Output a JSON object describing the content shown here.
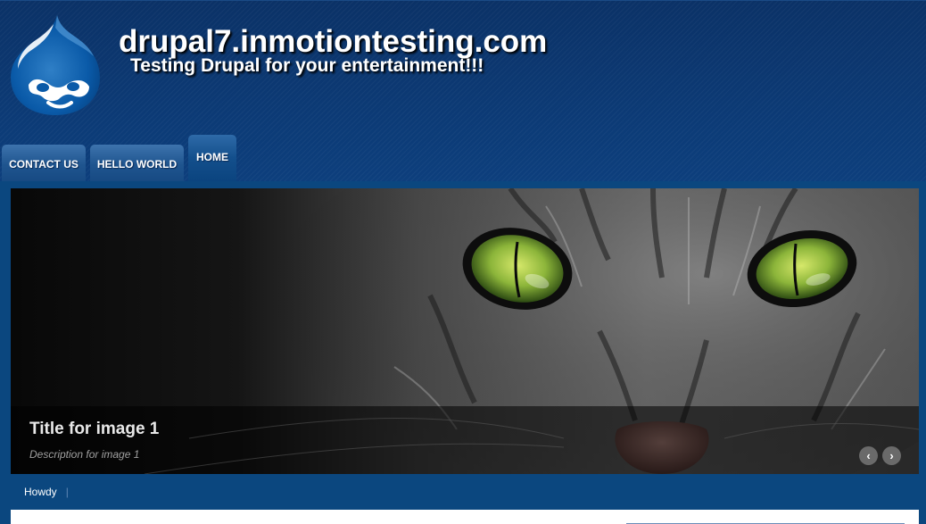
{
  "site": {
    "name": "drupal7.inmotiontesting.com",
    "slogan": "Testing Drupal for your entertainment!!!",
    "logo_icon": "drupal-drop-icon"
  },
  "nav": {
    "tabs": [
      {
        "label": "CONTACT US",
        "active": false
      },
      {
        "label": "HELLO WORLD",
        "active": false
      },
      {
        "label": "HOME",
        "active": true
      }
    ]
  },
  "slideshow": {
    "image": "cat-eyes-photo",
    "title": "Title for image 1",
    "description": "Description for image 1",
    "prev_icon": "‹",
    "next_icon": "›"
  },
  "secondary_menu": {
    "items": [
      "Howdy"
    ]
  },
  "colors": {
    "header_bg": "#0c3a75",
    "band_bg": "#0b477f",
    "tab_bg": "#1f558f"
  }
}
